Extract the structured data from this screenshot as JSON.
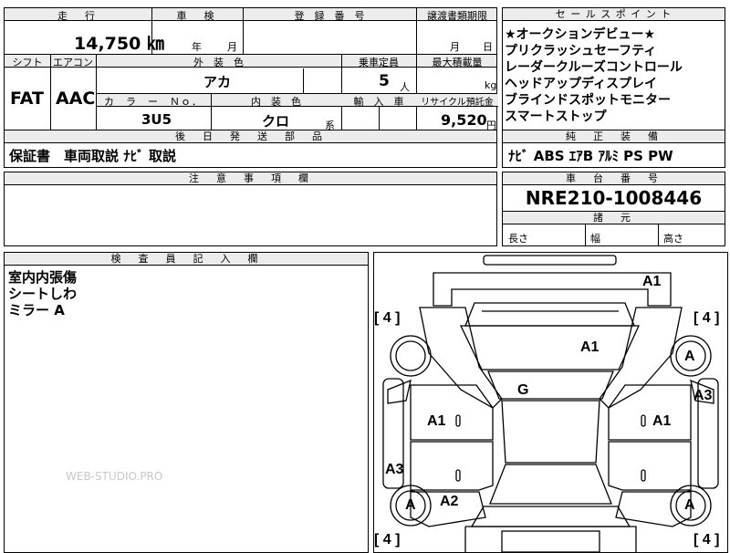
{
  "top_row": {
    "mileage_label": "走　行",
    "mileage": "14,750 ㎞",
    "shaken_label": "車　検",
    "shaken_year_unit": "年",
    "shaken_month_unit": "月",
    "reg_label": "登　録　番　号",
    "transfer_label": "譲渡書類期限",
    "transfer_month_unit": "月",
    "transfer_day_unit": "日"
  },
  "second_row": {
    "shift_label": "シフト",
    "shift": "FAT",
    "ac_label": "エアコン",
    "ac": "AAC",
    "exterior_label": "外　装　色",
    "exterior": "アカ",
    "capacity_label": "乗車定員",
    "capacity": "5",
    "capacity_unit": "人",
    "maxload_label": "最大積載量",
    "maxload_unit": "kg",
    "color_no_label": "カ　ラ　ー　Ｎｏ．",
    "color_no": "3U5",
    "interior_label": "内　装　色",
    "interior": "クロ",
    "interior_suffix": "系",
    "import_label": "輸　入　車",
    "recycle_label": "リサイクル預託金",
    "recycle": "9,520",
    "recycle_unit": "円"
  },
  "sales_points": {
    "label": "セ ー ル ス ポ イ ン ト",
    "items": [
      "★オークションデビュー★",
      "プリクラッシュセーフティ",
      "レーダークルーズコントロール",
      "ヘッドアップディスプレイ",
      "ブラインドスポットモニター",
      "スマートストップ"
    ]
  },
  "later_parts": {
    "label": "後　日　発　送　部　品",
    "value": "保証書　車両取説  ﾅﾋﾞ 取説"
  },
  "genuine_equipment": {
    "label": "純　正　装　備",
    "value": "ﾅﾋﾞ  ABS  ｴｱB  ｱﾙﾐ  PS  PW"
  },
  "notes": {
    "label": "注　意　事　項　欄",
    "value": ""
  },
  "chassis": {
    "label": "車　台　番　号",
    "value": "NRE210-1008446"
  },
  "dimensions": {
    "label": "諸　元",
    "length": "長さ",
    "width": "幅",
    "height": "高さ"
  },
  "inspector": {
    "label": "検　査　員　記　入　欄",
    "lines": [
      "室内内張傷",
      "シートしわ",
      "ミラー A"
    ]
  },
  "diagram": {
    "marks": {
      "front_right_top": "A1",
      "hood": "A1",
      "right_panel": "A3",
      "roof": "G",
      "left_front_door": "A1",
      "right_front_door": "A1",
      "left_rear_panel": "A3",
      "left_rear_door": "A2",
      "wheel_fl": "A",
      "wheel_fr": "A",
      "wheel_rl": "A",
      "wheel_rr": "A"
    },
    "tires": {
      "front_left": "[ 4 ]",
      "front_right": "[ 4 ]",
      "rear_left": "[ 4 ]",
      "rear_right": "[ 4 ]"
    }
  },
  "watermark": "WEB-STUDIO.PRO"
}
